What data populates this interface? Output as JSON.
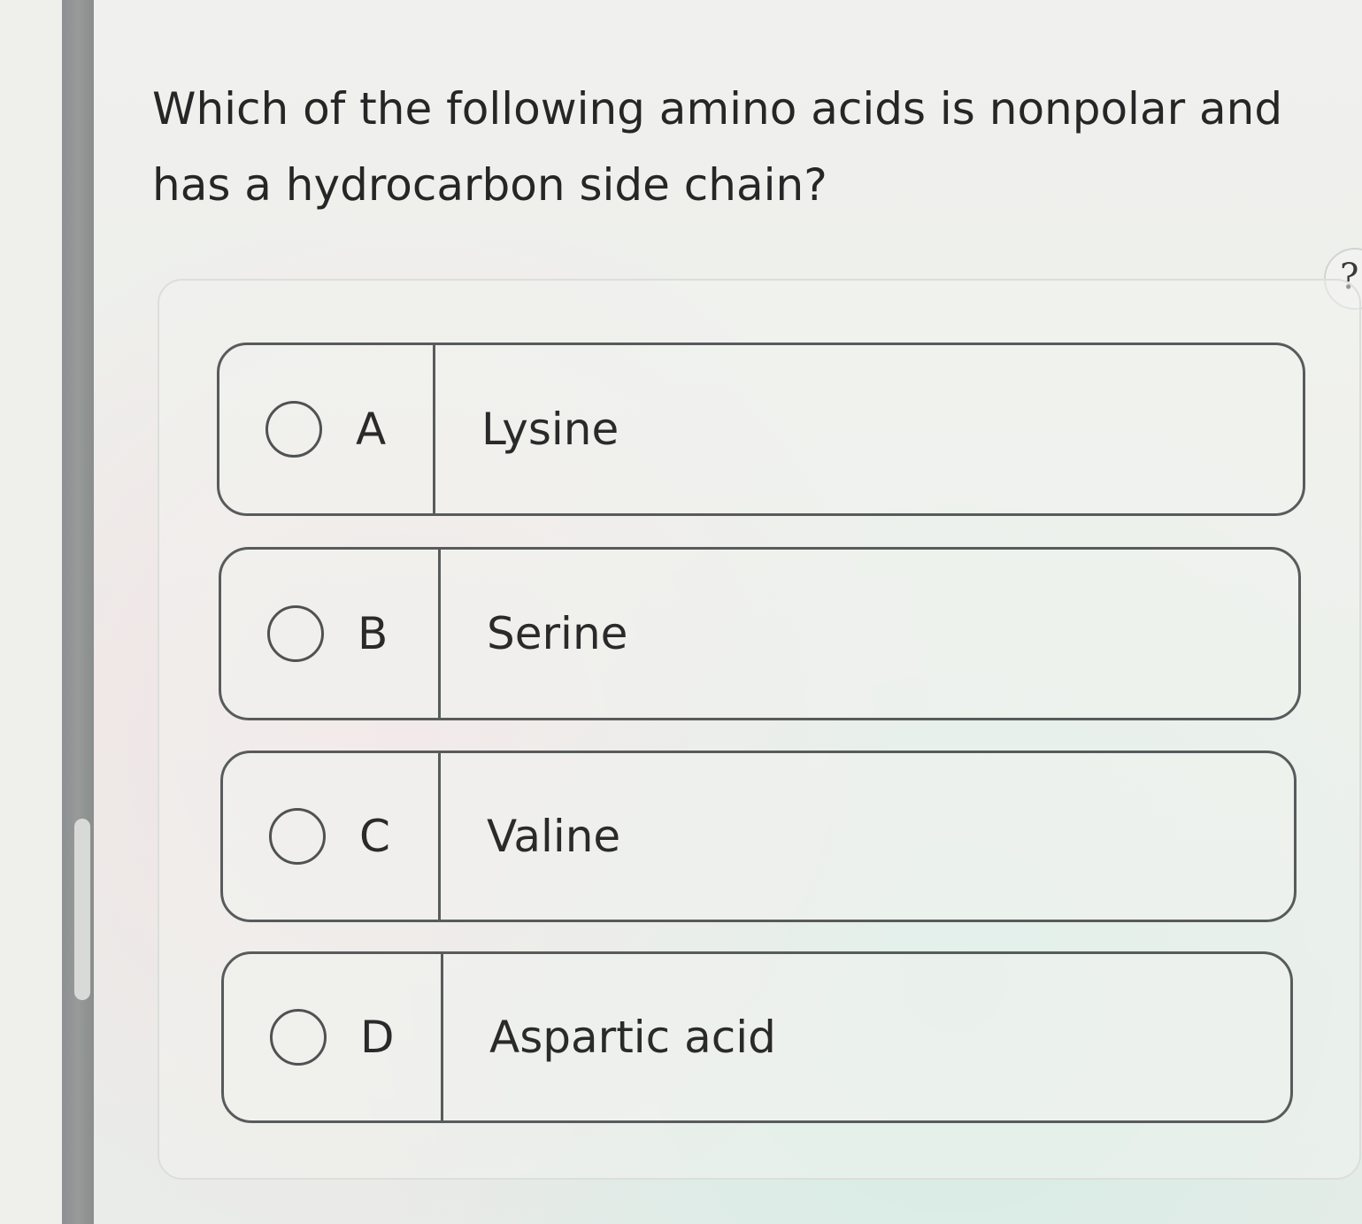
{
  "question": {
    "text": "Which of the following amino acids is nonpolar and has a hydrocarbon side chain?"
  },
  "help": {
    "glyph": "?"
  },
  "options": [
    {
      "letter": "A",
      "label": "Lysine"
    },
    {
      "letter": "B",
      "label": "Serine"
    },
    {
      "letter": "C",
      "label": "Valine"
    },
    {
      "letter": "D",
      "label": "Aspartic acid"
    }
  ],
  "colors": {
    "text": "#262626",
    "option_border": "#585b5b",
    "scroll_rail": "#8d9090",
    "background": "#eeefea"
  },
  "icons": {
    "help": "help-icon",
    "radio": "radio-icon"
  }
}
